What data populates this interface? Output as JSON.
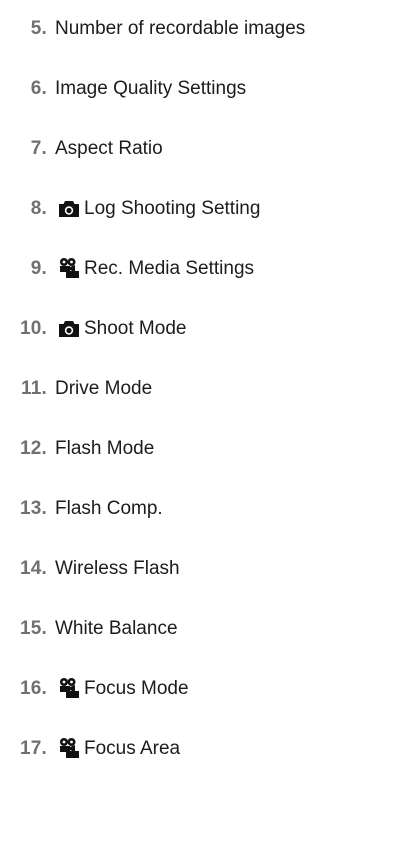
{
  "items": [
    {
      "num": "5.",
      "label": "Number of recordable images",
      "icon": ""
    },
    {
      "num": "6.",
      "label": "Image Quality Settings",
      "icon": ""
    },
    {
      "num": "7.",
      "label": "Aspect Ratio",
      "icon": ""
    },
    {
      "num": "8.",
      "label": "Log Shooting Setting",
      "icon": "camera-icon"
    },
    {
      "num": "9.",
      "label": "Rec. Media Settings",
      "icon": "camera-video-icon"
    },
    {
      "num": "10.",
      "label": "Shoot Mode",
      "icon": "camera-icon"
    },
    {
      "num": "11.",
      "label": "Drive Mode",
      "icon": ""
    },
    {
      "num": "12.",
      "label": "Flash Mode",
      "icon": ""
    },
    {
      "num": "13.",
      "label": "Flash Comp.",
      "icon": ""
    },
    {
      "num": "14.",
      "label": "Wireless Flash",
      "icon": ""
    },
    {
      "num": "15.",
      "label": "White Balance",
      "icon": ""
    },
    {
      "num": "16.",
      "label": "Focus Mode",
      "icon": "camera-video-icon"
    },
    {
      "num": "17.",
      "label": "Focus Area",
      "icon": "camera-video-icon"
    }
  ]
}
